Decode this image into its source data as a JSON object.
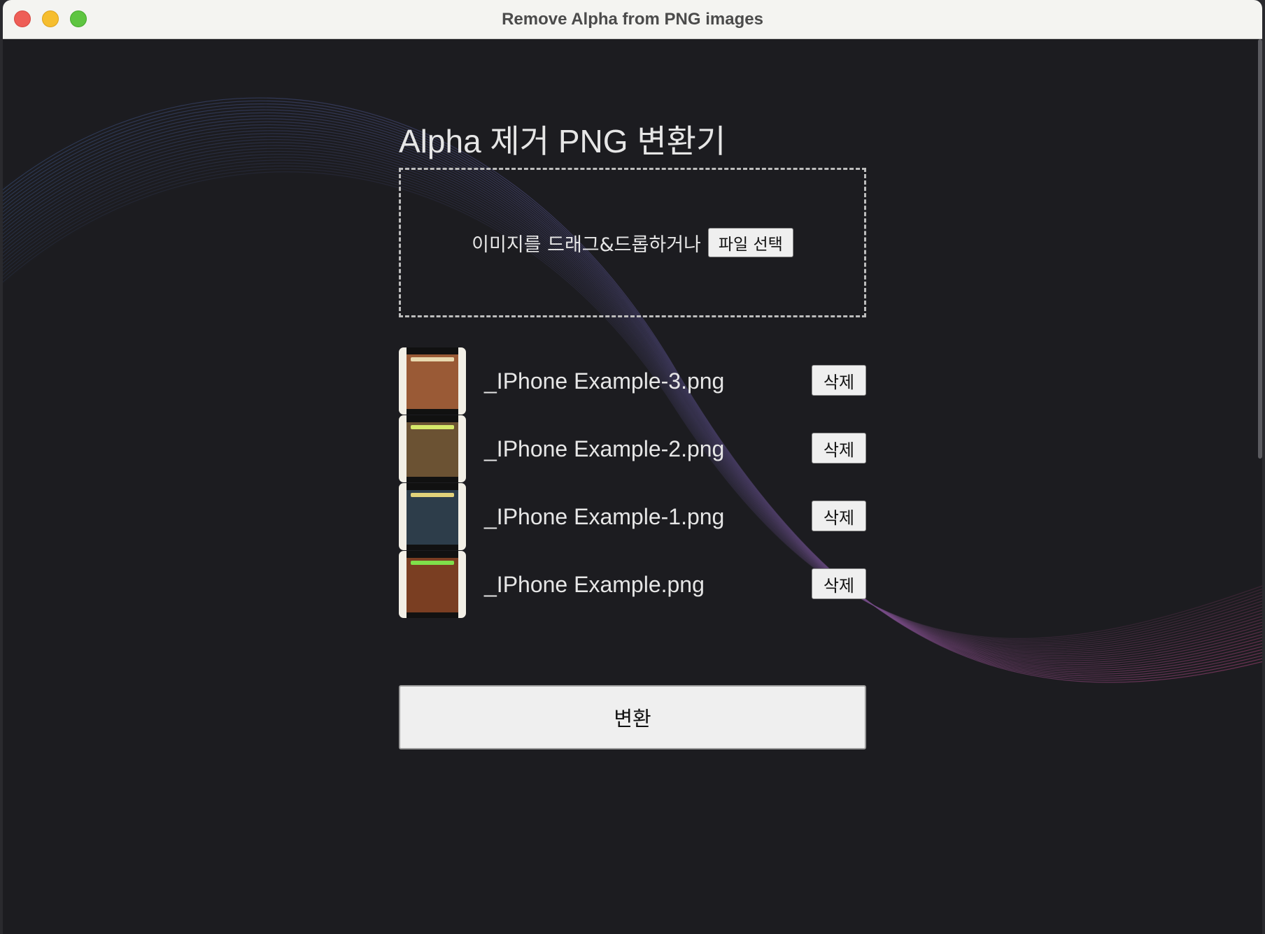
{
  "window": {
    "title": "Remove Alpha from PNG images"
  },
  "main": {
    "title": "Alpha 제거 PNG 변환기",
    "dropzone": {
      "text": "이미지를 드래그&드롭하거나",
      "button_label": "파일 선택"
    },
    "files": [
      {
        "name": "_IPhone Example-3.png",
        "delete_label": "삭제",
        "thumb_color": "#9a5a36",
        "caption_color": "#e8d9b0"
      },
      {
        "name": "_IPhone Example-2.png",
        "delete_label": "삭제",
        "thumb_color": "#6b5233",
        "caption_color": "#d6e86a"
      },
      {
        "name": "_IPhone Example-1.png",
        "delete_label": "삭제",
        "thumb_color": "#2d3d4a",
        "caption_color": "#e2d27a"
      },
      {
        "name": "_IPhone Example.png",
        "delete_label": "삭제",
        "thumb_color": "#7a3e22",
        "caption_color": "#7fe04a"
      }
    ],
    "convert_label": "변환"
  },
  "colors": {
    "background": "#1c1c20",
    "wave_blue": "#3f5f9a",
    "wave_pink": "#b4427a"
  }
}
